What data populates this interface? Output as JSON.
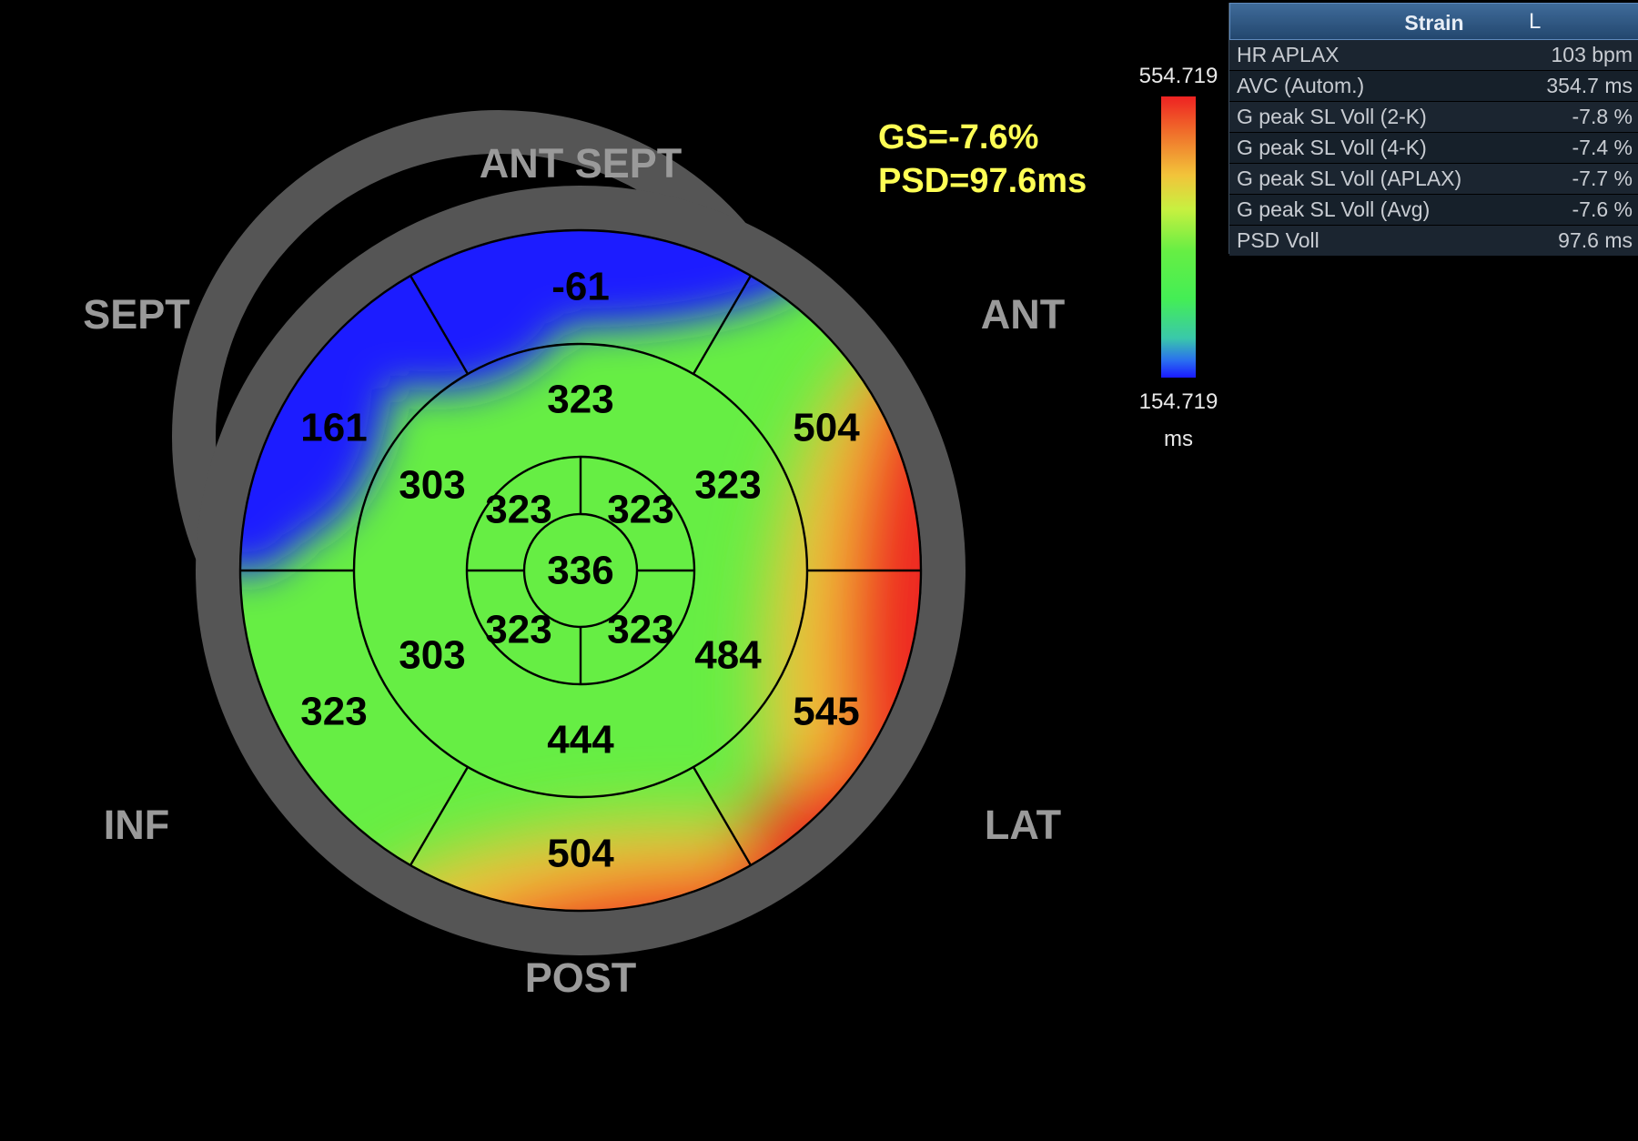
{
  "wall_labels": {
    "ant_sept": "ANT SEPT",
    "sept": "SEPT",
    "ant": "ANT",
    "inf": "INF",
    "lat": "LAT",
    "post": "POST"
  },
  "stats": {
    "gs": "GS=-7.6%",
    "psd": "PSD=97.6ms"
  },
  "color_scale": {
    "max": "554.719",
    "min": "154.719",
    "unit": "ms",
    "colors": {
      "high": "#ee2222",
      "mid": "#44ee55",
      "low": "#1a1aff"
    }
  },
  "segments": {
    "basal": [
      "-61",
      "504",
      "545",
      "504",
      "323",
      "161"
    ],
    "mid": [
      "323",
      "323",
      "484",
      "444",
      "303",
      "303"
    ],
    "apical": [
      "323",
      "323",
      "323",
      "323"
    ],
    "apex": "336"
  },
  "panel": {
    "title": "Strain",
    "tab": "L",
    "rows": [
      {
        "label": "HR APLAX",
        "value": "103 bpm"
      },
      {
        "label": "AVC (Autom.)",
        "value": "354.7 ms"
      },
      {
        "label": "G peak SL Voll (2-K)",
        "value": "-7.8 %"
      },
      {
        "label": "G peak SL Voll (4-K)",
        "value": "-7.4 %"
      },
      {
        "label": "G peak SL Voll (APLAX)",
        "value": "-7.7 %"
      },
      {
        "label": "G peak SL Voll (Avg)",
        "value": "-7.6 %"
      },
      {
        "label": "PSD Voll",
        "value": "97.6 ms"
      }
    ]
  }
}
